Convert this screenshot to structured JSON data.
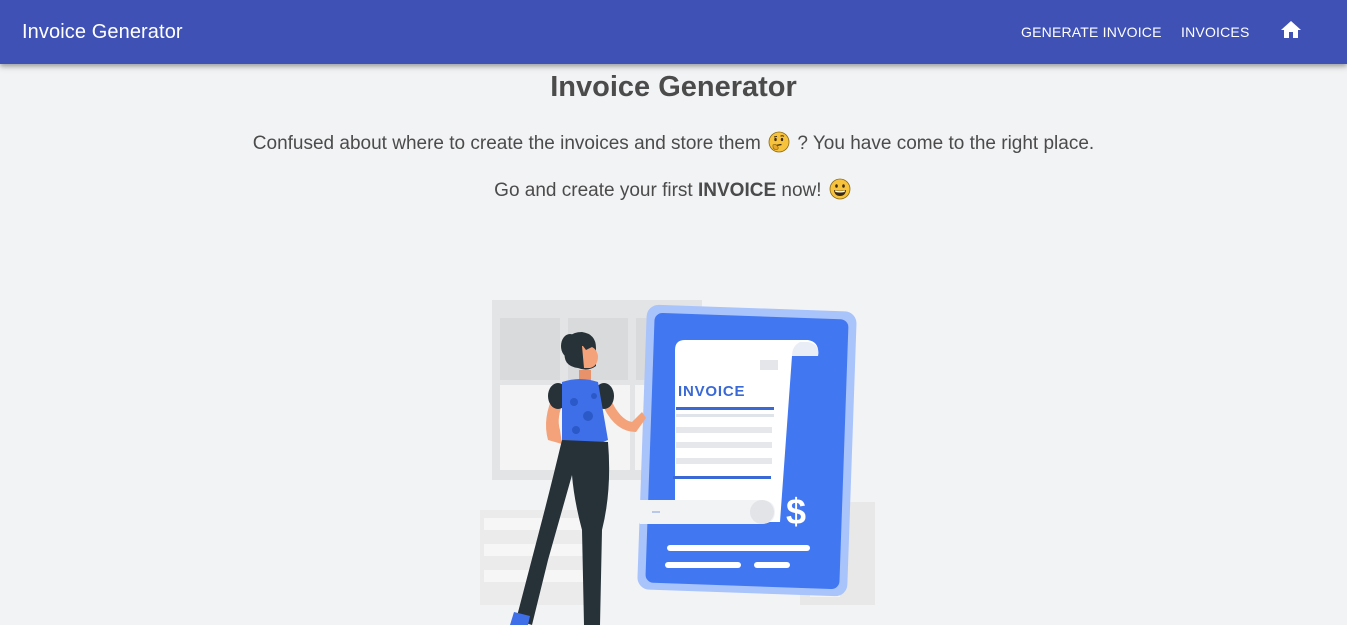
{
  "appbar": {
    "brand": "Invoice Generator",
    "nav": {
      "generate_invoice": "GENERATE INVOICE",
      "invoices": "INVOICES",
      "home_icon": "home-icon"
    },
    "color": "#3f51b5"
  },
  "hero": {
    "title": "Invoice Generator",
    "line1_before": "Confused about where to create the invoices and store them",
    "line1_after": "? You have come to the right place.",
    "line1_emoji": "thinking-face-icon",
    "line2_before": "Go and create your first",
    "line2_bold": "INVOICE",
    "line2_after": "now!",
    "line2_emoji": "grinning-face-icon"
  },
  "illustration": {
    "invoice_heading": "INVOICE",
    "currency_symbol": "$",
    "accent_color": "#4177f0"
  }
}
